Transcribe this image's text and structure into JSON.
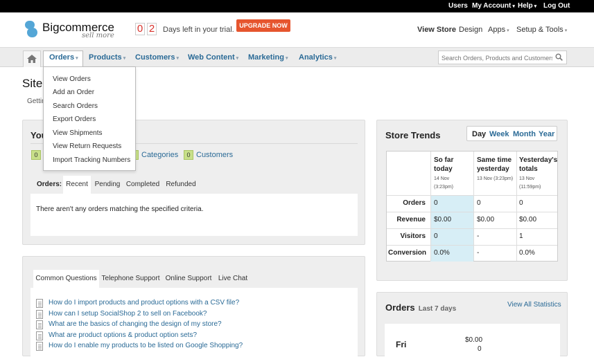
{
  "topbar": {
    "users": "Users",
    "my_account": "My Account",
    "help": "Help",
    "logout": "Log Out"
  },
  "header": {
    "logo_name": "Bigcommerce",
    "logo_tagline": "sell more",
    "trial_days": [
      "0",
      "2"
    ],
    "trial_text": "Days left in your trial.",
    "upgrade_label": "UPGRADE NOW",
    "view_store": "View Store",
    "design": "Design",
    "apps": "Apps",
    "setup_tools": "Setup & Tools"
  },
  "nav": {
    "orders": "Orders",
    "products": "Products",
    "customers": "Customers",
    "web_content": "Web Content",
    "marketing": "Marketing",
    "analytics": "Analytics",
    "search_placeholder": "Search Orders, Products and Customers"
  },
  "dropdown": {
    "items": [
      "View Orders",
      "Add an Order",
      "Search Orders",
      "Export Orders",
      "View Shipments",
      "View Return Requests",
      "Import Tracking Numbers"
    ]
  },
  "page": {
    "title": "Site",
    "subtitle": "Gettin"
  },
  "your_store": {
    "title": "You",
    "categories_count": "0",
    "categories_label": "Categories",
    "customers_count": "0",
    "customers_label": "Customers",
    "left_count": "0",
    "orders_label": "Orders:",
    "tabs": [
      "Recent",
      "Pending",
      "Completed",
      "Refunded"
    ],
    "empty_message": "There aren't any orders matching the specified criteria."
  },
  "support": {
    "tabs": [
      "Common Questions",
      "Telephone Support",
      "Online Support",
      "Live Chat"
    ],
    "questions": [
      "How do I import products and product options with a CSV file?",
      "How can I setup SocialShop 2 to sell on Facebook?",
      "What are the basics of changing the design of my store?",
      "What are product options & product option sets?",
      "How do I enable my products to be listed on Google Shopping?"
    ]
  },
  "store_trends": {
    "title": "Store Trends",
    "periods": [
      "Day",
      "Week",
      "Month",
      "Year"
    ],
    "columns": [
      {
        "title_1": "So far",
        "title_2": "today",
        "date_1": "14 Nov",
        "date_2": "(3:23pm)"
      },
      {
        "title_1": "Same time",
        "title_2": "yesterday",
        "date_1": "13 Nov (3:23pm)",
        "date_2": ""
      },
      {
        "title_1": "Yesterday's",
        "title_2": "totals",
        "date_1": "13 Nov",
        "date_2": "(11:59pm)"
      }
    ],
    "rows": [
      {
        "label": "Orders",
        "values": [
          "0",
          "0",
          "0"
        ]
      },
      {
        "label": "Revenue",
        "values": [
          "$0.00",
          "$0.00",
          "$0.00"
        ]
      },
      {
        "label": "Visitors",
        "values": [
          "0",
          "-",
          "1"
        ]
      },
      {
        "label": "Conversion",
        "values": [
          "0.0%",
          "-",
          "0.0%"
        ]
      }
    ]
  },
  "orders_panel": {
    "title": "Orders",
    "subtitle": "Last 7 days",
    "view_all": "View All Statistics",
    "day": "Fri",
    "amount": "$0.00",
    "count": "0"
  },
  "colors": {
    "link": "#2a6a96",
    "upgrade": "#e6552e",
    "badge": "#c8e08a",
    "highlight_col": "#d7eef6"
  }
}
